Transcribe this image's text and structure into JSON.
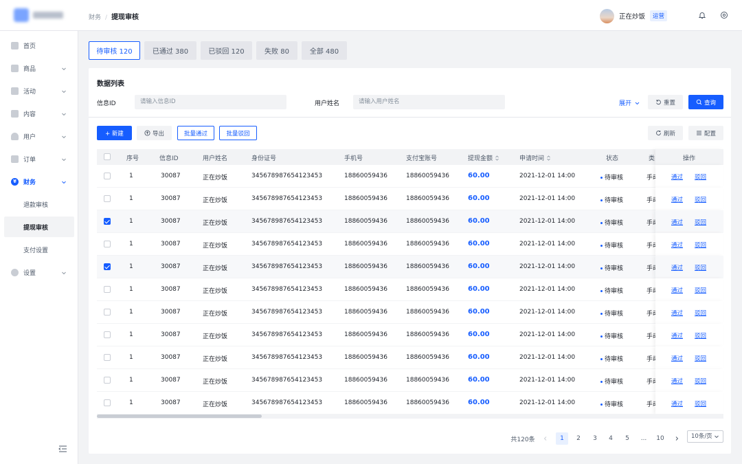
{
  "breadcrumb": {
    "parent": "财务",
    "separator": "/",
    "current": "提现审核"
  },
  "user": {
    "name": "正在炒饭",
    "role": "运营"
  },
  "sidebar": {
    "items": [
      {
        "label": "首页",
        "icon": "home-icon"
      },
      {
        "label": "商品",
        "icon": "goods-icon"
      },
      {
        "label": "活动",
        "icon": "activity-icon"
      },
      {
        "label": "内容",
        "icon": "content-icon"
      },
      {
        "label": "用户",
        "icon": "user-icon"
      },
      {
        "label": "订单",
        "icon": "order-icon"
      },
      {
        "label": "财务",
        "icon": "finance-icon",
        "icon_char": "¥"
      },
      {
        "label": "设置",
        "icon": "settings-icon"
      }
    ],
    "finance_sub": [
      {
        "label": "退款审核"
      },
      {
        "label": "提现审核"
      },
      {
        "label": "支付设置"
      }
    ]
  },
  "tabs": [
    {
      "label": "待审核 120"
    },
    {
      "label": "已通过 380"
    },
    {
      "label": "已驳回 120"
    },
    {
      "label": "失败 80"
    },
    {
      "label": "全部 480"
    }
  ],
  "card": {
    "title": "数据列表",
    "filters": {
      "info_id_label": "信息ID",
      "info_id_placeholder": "请输入信息ID",
      "username_label": "用户姓名",
      "username_placeholder": "请输入用户姓名",
      "expand": "展开",
      "reset": "重置",
      "query": "查询"
    },
    "toolbar": {
      "new": "+ 新建",
      "export": "导出",
      "batch_pass": "批量通过",
      "batch_reject": "批量驳回",
      "refresh": "刷新",
      "config": "配置"
    }
  },
  "table": {
    "columns": [
      "序号",
      "信息ID",
      "用户姓名",
      "身份证号",
      "手机号",
      "支付宝账号",
      "提现金额",
      "申请时间",
      "状态",
      "类",
      "操作"
    ],
    "rows": [
      {
        "no": "1",
        "id": "30087",
        "name": "正在炒饭",
        "idcard": "345678987654123453",
        "phone": "18860059436",
        "alipay": "18860059436",
        "amount": "60.00",
        "time": "2021-12-01  14:00",
        "status": "待审核",
        "type": "手动",
        "selected": false
      },
      {
        "no": "1",
        "id": "30087",
        "name": "正在炒饭",
        "idcard": "345678987654123453",
        "phone": "18860059436",
        "alipay": "18860059436",
        "amount": "60.00",
        "time": "2021-12-01  14:00",
        "status": "待审核",
        "type": "手动",
        "selected": false
      },
      {
        "no": "1",
        "id": "30087",
        "name": "正在炒饭",
        "idcard": "345678987654123453",
        "phone": "18860059436",
        "alipay": "18860059436",
        "amount": "60.00",
        "time": "2021-12-01  14:00",
        "status": "待审核",
        "type": "手动",
        "selected": true
      },
      {
        "no": "1",
        "id": "30087",
        "name": "正在炒饭",
        "idcard": "345678987654123453",
        "phone": "18860059436",
        "alipay": "18860059436",
        "amount": "60.00",
        "time": "2021-12-01  14:00",
        "status": "待审核",
        "type": "手动",
        "selected": false
      },
      {
        "no": "1",
        "id": "30087",
        "name": "正在炒饭",
        "idcard": "345678987654123453",
        "phone": "18860059436",
        "alipay": "18860059436",
        "amount": "60.00",
        "time": "2021-12-01  14:00",
        "status": "待审核",
        "type": "手动",
        "selected": true
      },
      {
        "no": "1",
        "id": "30087",
        "name": "正在炒饭",
        "idcard": "345678987654123453",
        "phone": "18860059436",
        "alipay": "18860059436",
        "amount": "60.00",
        "time": "2021-12-01  14:00",
        "status": "待审核",
        "type": "手动",
        "selected": false
      },
      {
        "no": "1",
        "id": "30087",
        "name": "正在炒饭",
        "idcard": "345678987654123453",
        "phone": "18860059436",
        "alipay": "18860059436",
        "amount": "60.00",
        "time": "2021-12-01  14:00",
        "status": "待审核",
        "type": "手动",
        "selected": false
      },
      {
        "no": "1",
        "id": "30087",
        "name": "正在炒饭",
        "idcard": "345678987654123453",
        "phone": "18860059436",
        "alipay": "18860059436",
        "amount": "60.00",
        "time": "2021-12-01  14:00",
        "status": "待审核",
        "type": "手动",
        "selected": false
      },
      {
        "no": "1",
        "id": "30087",
        "name": "正在炒饭",
        "idcard": "345678987654123453",
        "phone": "18860059436",
        "alipay": "18860059436",
        "amount": "60.00",
        "time": "2021-12-01  14:00",
        "status": "待审核",
        "type": "手动",
        "selected": false
      },
      {
        "no": "1",
        "id": "30087",
        "name": "正在炒饭",
        "idcard": "345678987654123453",
        "phone": "18860059436",
        "alipay": "18860059436",
        "amount": "60.00",
        "time": "2021-12-01  14:00",
        "status": "待审核",
        "type": "手动",
        "selected": false
      },
      {
        "no": "1",
        "id": "30087",
        "name": "正在炒饭",
        "idcard": "345678987654123453",
        "phone": "18860059436",
        "alipay": "18860059436",
        "amount": "60.00",
        "time": "2021-12-01  14:00",
        "status": "待审核",
        "type": "手动",
        "selected": false
      }
    ],
    "op_pass": "通过",
    "op_reject": "驳回"
  },
  "pagination": {
    "total": "共120条",
    "pages": [
      "1",
      "2",
      "3",
      "4",
      "5",
      "...",
      "10"
    ],
    "current": "1",
    "page_size": "10条/页"
  },
  "colors": {
    "primary": "#165dff",
    "bg": "#f2f3f5"
  }
}
